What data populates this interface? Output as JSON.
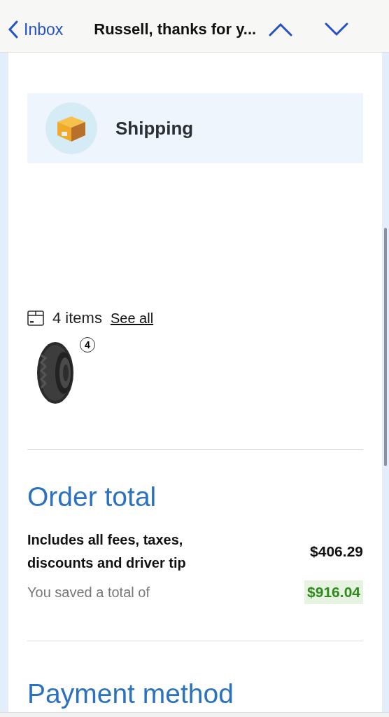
{
  "header": {
    "back_label": "Inbox",
    "title": "Russell, thanks for y..."
  },
  "shipping": {
    "label": "Shipping"
  },
  "items": {
    "count": "4 items",
    "link": "See all",
    "products": [
      {
        "kind": "picture",
        "quantity": "4"
      }
    ]
  },
  "order_total": {
    "heading": "Order total",
    "description": "Includes all fees, taxes, discounts and driver tip",
    "amount": "$406.29",
    "savings_label": "You saved a total of",
    "savings_amount": "$916.04"
  },
  "payment": {
    "heading": "Payment method"
  }
}
